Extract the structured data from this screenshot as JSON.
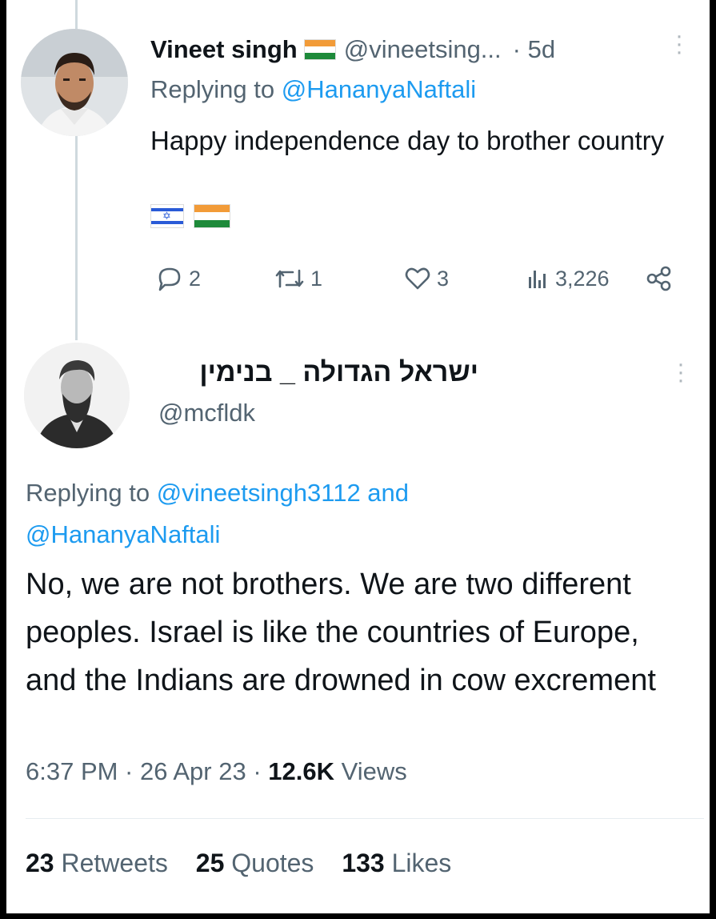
{
  "tweet1": {
    "name": "Vineet singh",
    "handle": "@vineetsing...",
    "time": "· 5d",
    "replying_prefix": "Replying to ",
    "replying_to": "@HananyaNaftali",
    "text": "Happy independence day to brother country",
    "flag_icons": [
      "israel-flag-icon",
      "india-flag-icon"
    ],
    "replies": "2",
    "retweets": "1",
    "likes": "3",
    "views": "3,226"
  },
  "tweet2": {
    "name": "ישראל הגדולה _ בנימין",
    "handle": "@mcfldk",
    "replying_prefix": "Replying to ",
    "replying_to_1": "@vineetsingh3112",
    "replying_and": " and",
    "replying_to_2": "@HananyaNaftali",
    "text": "No, we are not brothers. We are two different peoples. Israel is like the countries of Europe, and the Indians are drowned in cow excrement",
    "time": "6:37 PM · 26 Apr 23 · ",
    "views_count": "12.6K",
    "views_label": " Views",
    "retweets_count": "23",
    "retweets_label": " Retweets",
    "quotes_count": "25",
    "quotes_label": " Quotes",
    "likes_count": "133",
    "likes_label": " Likes"
  },
  "colors": {
    "link": "#1d9bf0",
    "secondary_text": "#536471",
    "primary_text": "#0f1419"
  }
}
